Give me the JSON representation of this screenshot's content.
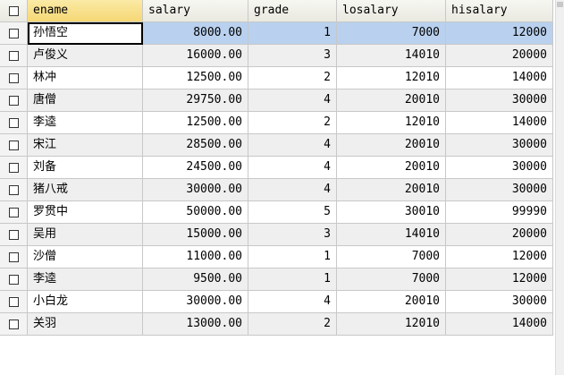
{
  "columns": [
    "ename",
    "salary",
    "grade",
    "losalary",
    "hisalary"
  ],
  "rows": [
    {
      "ename": "孙悟空",
      "salary": "8000.00",
      "grade": "1",
      "losalary": "7000",
      "hisalary": "12000"
    },
    {
      "ename": "卢俊义",
      "salary": "16000.00",
      "grade": "3",
      "losalary": "14010",
      "hisalary": "20000"
    },
    {
      "ename": "林冲",
      "salary": "12500.00",
      "grade": "2",
      "losalary": "12010",
      "hisalary": "14000"
    },
    {
      "ename": "唐僧",
      "salary": "29750.00",
      "grade": "4",
      "losalary": "20010",
      "hisalary": "30000"
    },
    {
      "ename": "李逵",
      "salary": "12500.00",
      "grade": "2",
      "losalary": "12010",
      "hisalary": "14000"
    },
    {
      "ename": "宋江",
      "salary": "28500.00",
      "grade": "4",
      "losalary": "20010",
      "hisalary": "30000"
    },
    {
      "ename": "刘备",
      "salary": "24500.00",
      "grade": "4",
      "losalary": "20010",
      "hisalary": "30000"
    },
    {
      "ename": "猪八戒",
      "salary": "30000.00",
      "grade": "4",
      "losalary": "20010",
      "hisalary": "30000"
    },
    {
      "ename": "罗贯中",
      "salary": "50000.00",
      "grade": "5",
      "losalary": "30010",
      "hisalary": "99990"
    },
    {
      "ename": "吴用",
      "salary": "15000.00",
      "grade": "3",
      "losalary": "14010",
      "hisalary": "20000"
    },
    {
      "ename": "沙僧",
      "salary": "11000.00",
      "grade": "1",
      "losalary": "7000",
      "hisalary": "12000"
    },
    {
      "ename": "李逵",
      "salary": "9500.00",
      "grade": "1",
      "losalary": "7000",
      "hisalary": "12000"
    },
    {
      "ename": "小白龙",
      "salary": "30000.00",
      "grade": "4",
      "losalary": "20010",
      "hisalary": "30000"
    },
    {
      "ename": "关羽",
      "salary": "13000.00",
      "grade": "2",
      "losalary": "12010",
      "hisalary": "14000"
    }
  ],
  "selected_row": 0,
  "colors": {
    "selection": "#b9d1ee",
    "header_active": "#f5d774",
    "alt_row": "#efefef"
  }
}
